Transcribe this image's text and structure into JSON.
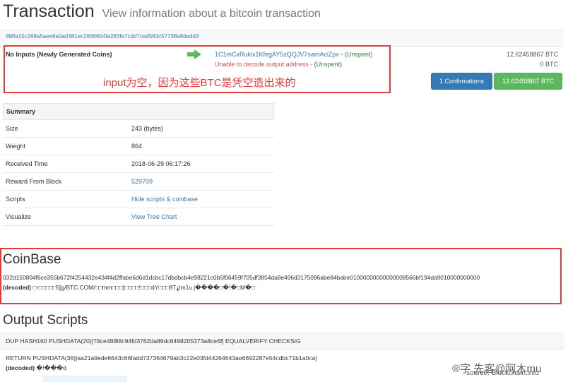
{
  "header": {
    "title": "Transaction",
    "subtitle": "View information about a bitcoin transaction"
  },
  "tx": {
    "hash": "99ffa15c268a5aee6a0a0381ec2666654fa283fe7cdd7ced583c57738e8dadd3",
    "inputs_label": "No Inputs (Newly Generated Coins)",
    "outputs": [
      {
        "address": "1C1mCxRukix1KfegAY5zQQJV7samAciZpv",
        "sep": " - ",
        "status": "(Unspent)",
        "amount": "12.62458867 BTC"
      },
      {
        "address": "Unable to decode output address",
        "sep": " - ",
        "status": "(Unspent)",
        "amount": "0 BTC"
      }
    ],
    "confirmations_button": "1 Confirmations",
    "total_button": "12.62458867 BTC"
  },
  "annotation": {
    "note": "input为空，因为这些BTC是凭空造出来的",
    "color": "#e23c3c"
  },
  "summary": {
    "heading": "Summary",
    "rows": [
      {
        "key": "Size",
        "value": "243 (bytes)"
      },
      {
        "key": "Weight",
        "value": "864"
      },
      {
        "key": "Received Time",
        "value": "2018-06-29 06:17:26"
      },
      {
        "key": "Reward From Block",
        "value": "529709"
      },
      {
        "key": "Scripts",
        "value": "Hide scripts & coinbase"
      },
      {
        "key": "Visualize",
        "value": "View Tree Chart"
      }
    ]
  },
  "coinbase": {
    "title": "CoinBase",
    "hex": "032d150804f6ce355b672f4254432e434f4d2ffabe6d6d1dcbc17dbdbcb4e98221c0b5f06459f705df3854da8e496d3175096abe84babe01000000000000008566bf194da9010000000000",
    "decoded_label": "(decoded)",
    "decoded": " □-□□□□□5[g/BTC.COM/□□mm□□□}□□□□!□□□dY□□□8T⸘lm1u j����□�!�□M�□"
  },
  "output_scripts": {
    "title": "Output Scripts",
    "script1": "DUP HASH160 PUSHDATA(20)[78ce48f88c94fd3762da89dc8498205373a8ce6f] EQUALVERIFY CHECKSIG",
    "script2": "RETURN PUSHDATA(36)[aa21a9ede6643c66fadd737364679ab3c22e03fd44264643ae6692287e54cdbc71b1a0ca]",
    "decoded_label": "(decoded)",
    "decoded": " �!���d"
  },
  "watermark": {
    "text": "®字 先客@阿木mu",
    "source": "source: Blockchain.info"
  }
}
